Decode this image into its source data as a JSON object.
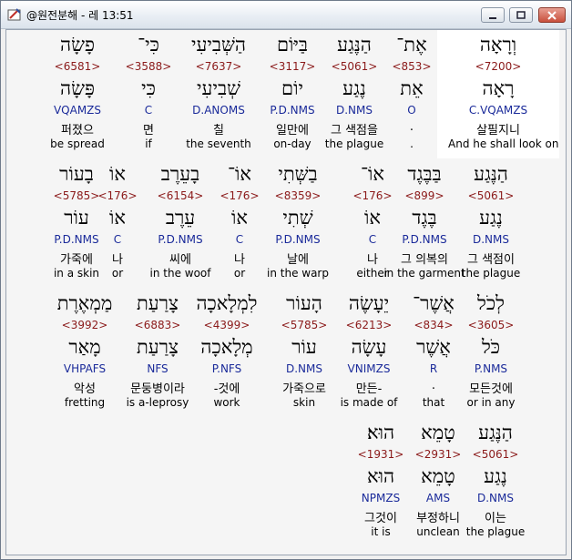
{
  "window": {
    "title": "@원전분해 - 레 13:51",
    "minimize_icon": "minimize-icon",
    "maximize_icon": "maximize-icon",
    "close_icon": "close-icon"
  },
  "rows": [
    {
      "words": [
        {
          "heb": "וְרָאָה",
          "num": "<7200>",
          "lemma": "רָאָה",
          "gram": "C.VQAMZS",
          "ko": "살필지니",
          "en": "And he shall look on",
          "highlighted": true
        },
        {
          "heb": "אֶת־",
          "num": "<853>",
          "lemma": "אֵת",
          "gram": "O",
          "ko": ".",
          "en": "."
        },
        {
          "heb": "הַנֶּגַע",
          "num": "<5061>",
          "lemma": "נֶגַע",
          "gram": "D.NMS",
          "ko": "그 색점을",
          "en": "the plague"
        },
        {
          "heb": "בַּיּוֹם",
          "num": "<3117>",
          "lemma": "יוֹם",
          "gram": "P.D.NMS",
          "ko": "일만에",
          "en": "on-day"
        },
        {
          "heb": "הַשְּׁבִיעִי",
          "num": "<7637>",
          "lemma": "שְׁבִיעִי",
          "gram": "D.ANOMS",
          "ko": "칠",
          "en": "the seventh"
        },
        {
          "heb": "כִּי־",
          "num": "<3588>",
          "lemma": "כִּי",
          "gram": "C",
          "ko": "면",
          "en": "if"
        },
        {
          "heb": "פָשָׂה",
          "num": "<6581>",
          "lemma": "פָּשָׂה",
          "gram": "VQAMZS",
          "ko": "퍼졌으",
          "en": "be spread"
        }
      ]
    },
    {
      "words": [
        {
          "heb": "הַנֶּגַע",
          "num": "<5061>",
          "lemma": "נֶגַע",
          "gram": "D.NMS",
          "ko": "그 색점이",
          "en": "the plague"
        },
        {
          "heb": "בַּבֶּגֶד",
          "num": "<899>",
          "lemma": "בֶּגֶד",
          "gram": "P.D.NMS",
          "ko": "그 의복의",
          "en": "in the garment"
        },
        {
          "heb": "אוֹ־",
          "num": "<176>",
          "lemma": "אוֹ",
          "gram": "C",
          "ko": "나",
          "en": "either"
        },
        {
          "heb": "בַשְּׁתִי",
          "num": "<8359>",
          "lemma": "שְׁתִי",
          "gram": "P.D.NMS",
          "ko": "날에",
          "en": "in the warp"
        },
        {
          "heb": "אוֹ־",
          "num": "<176>",
          "lemma": "אוֹ",
          "gram": "C",
          "ko": "나",
          "en": "or"
        },
        {
          "heb": "בָעֵרֶב",
          "num": "<6154>",
          "lemma": "עֵרֶב",
          "gram": "P.D.NMS",
          "ko": "씨에",
          "en": "in the woof"
        },
        {
          "heb": "אוֹ",
          "num": "<176>",
          "lemma": "אוֹ",
          "gram": "C",
          "ko": "나",
          "en": "or"
        },
        {
          "heb": "בָעוֹר",
          "num": "<5785>",
          "lemma": "עוֹר",
          "gram": "P.D.NMS",
          "ko": "가죽에",
          "en": "in a skin"
        }
      ]
    },
    {
      "words": [
        {
          "heb": "לְכֹל",
          "num": "<3605>",
          "lemma": "כֹּל",
          "gram": "P.NMS",
          "ko": "모든것에",
          "en": "or in any"
        },
        {
          "heb": "אֲשֶׁר־",
          "num": "<834>",
          "lemma": "אֲשֶׁר",
          "gram": "R",
          "ko": ".",
          "en": "that"
        },
        {
          "heb": "יֵעָשֶׂה",
          "num": "<6213>",
          "lemma": "עָשָׂה",
          "gram": "VNIMZS",
          "ko": "만든-",
          "en": "is made of"
        },
        {
          "heb": "הָעוֹר",
          "num": "<5785>",
          "lemma": "עוֹר",
          "gram": "D.NMS",
          "ko": "가죽으로",
          "en": "skin"
        },
        {
          "heb": "לִמְלָאכָה",
          "num": "<4399>",
          "lemma": "מְלָאכָה",
          "gram": "P.NFS",
          "ko": "-것에",
          "en": "work"
        },
        {
          "heb": "צָרַעַת",
          "num": "<6883>",
          "lemma": "צָרַעַת",
          "gram": "NFS",
          "ko": "문둥병이라",
          "en": "is a-leprosy"
        },
        {
          "heb": "מַמְאֶרֶת",
          "num": "<3992>",
          "lemma": "מָאַר",
          "gram": "VHPAFS",
          "ko": "악성",
          "en": "fretting"
        }
      ]
    },
    {
      "words": [
        {
          "heb": "הַנֶּגַע",
          "num": "<5061>",
          "lemma": "נֶגַע",
          "gram": "D.NMS",
          "ko": "이는",
          "en": "the plague"
        },
        {
          "heb": "טָמֵא",
          "num": "<2931>",
          "lemma": "טָמֵא",
          "gram": "AMS",
          "ko": "부정하니",
          "en": "unclean"
        },
        {
          "heb": "הוּא׃",
          "num": "<1931>",
          "lemma": "הוּא",
          "gram": "NPMZS",
          "ko": "그것이",
          "en": "it is"
        }
      ]
    }
  ]
}
